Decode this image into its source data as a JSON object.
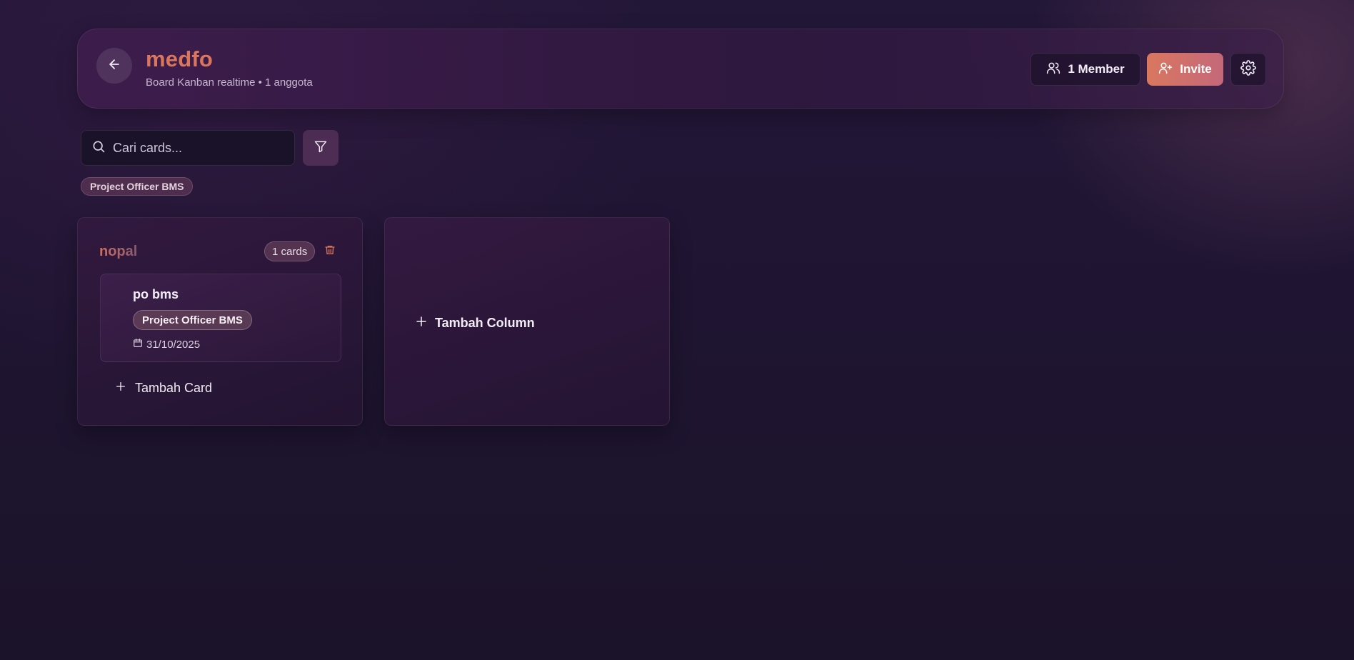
{
  "header": {
    "title": "medfo",
    "subtitle": "Board Kanban realtime • 1 anggota",
    "member_label": "1 Member",
    "invite_label": "Invite"
  },
  "search": {
    "placeholder": "Cari cards...",
    "value": ""
  },
  "filters": {
    "active_chip": "Project Officer BMS"
  },
  "columns": [
    {
      "title": "nopal",
      "count_label": "1 cards",
      "cards": [
        {
          "title": "po bms",
          "tag": "Project Officer BMS",
          "date": "31/10/2025"
        }
      ],
      "add_card_label": "Tambah Card"
    }
  ],
  "add_column_label": "Tambah Column",
  "colors": {
    "accent": "#d9765c",
    "invite_gradient_start": "#d9775f",
    "invite_gradient_end": "#c4687a",
    "delete_icon": "#d9765c"
  },
  "icons": {
    "back": "arrow-left-icon",
    "member": "users-icon",
    "invite": "user-plus-icon",
    "settings": "gear-icon",
    "search": "search-icon",
    "filter": "filter-icon",
    "delete": "trash-icon",
    "date": "calendar-icon",
    "add": "plus-icon"
  }
}
